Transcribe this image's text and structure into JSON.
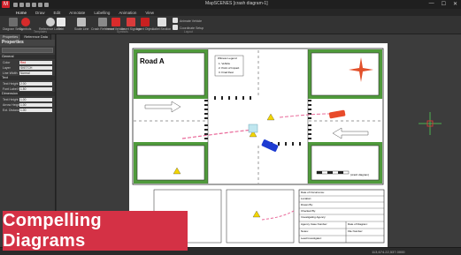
{
  "window": {
    "title": "MapSCENES [crash diagram-1]",
    "app_logo": "M",
    "controls": [
      "—",
      "☐",
      "✕"
    ]
  },
  "menu": {
    "tabs": [
      "Home",
      "Draw",
      "Edit",
      "Annotate",
      "Labelling",
      "Animation",
      "View"
    ],
    "active": "Home"
  },
  "ribbon": {
    "buttons": [
      {
        "label": "Diagram Setup",
        "icon": "diagram-setup-icon"
      },
      {
        "label": "Symbols",
        "icon": "symbols-icon"
      },
      {
        "label": "Reference Label",
        "icon": "reference-label-icon"
      },
      {
        "label": "Text",
        "icon": "text-icon"
      },
      {
        "label": "Scale Line",
        "icon": "scale-line-icon"
      },
      {
        "label": "Crash Reference",
        "icon": "crash-reference-icon"
      },
      {
        "label": "Insert Vehicle",
        "icon": "vehicle-icon"
      },
      {
        "label": "Insert Signage",
        "icon": "signage-icon"
      },
      {
        "label": "Insert Object",
        "icon": "object-icon"
      },
      {
        "label": "Label Section",
        "icon": "label-section-icon"
      },
      {
        "label": "Animate Vehicle",
        "icon": "animate-icon"
      },
      {
        "label": "Coordinate Setup",
        "icon": "coordinate-icon"
      }
    ],
    "groups": [
      "Templates",
      "Symbols",
      "Layout"
    ]
  },
  "panel": {
    "tabs": [
      "Properties",
      "Reference Data"
    ],
    "title": "Properties",
    "sections": [
      {
        "name": "General",
        "rows": [
          {
            "key": "Color",
            "value": "Red"
          },
          {
            "key": "Layer",
            "value": "SKETCH"
          },
          {
            "key": "Line Width",
            "value": "Normal"
          }
        ]
      },
      {
        "name": "Text",
        "rows": [
          {
            "key": "Text Height",
            "value": "2.00"
          },
          {
            "key": "Font Label Height",
            "value": "1.50"
          }
        ]
      },
      {
        "name": "Dimension",
        "rows": [
          {
            "key": "Text Height",
            "value": "1.00"
          },
          {
            "key": "Arrow Height",
            "value": "1.00"
          },
          {
            "key": "Ext. Distance",
            "value": "1.00"
          }
        ]
      }
    ]
  },
  "diagram": {
    "road_label": "Road A",
    "legend_title": "Witness Legend",
    "legend_items": [
      "1. Vehicle",
      "2. Point of Impact",
      "3. Final Rest"
    ],
    "info_rows": [
      "Date of Occurrence:",
      "Location:",
      "Drawn By:",
      "Checked By:",
      "Investigating Agency:",
      "Agency Case Number:",
      "Notes:",
      "Lead Investigator:",
      "Report Number:"
    ],
    "right_col": [
      "Date of Diagram:",
      "File Number:"
    ],
    "diagram_label": "(crash diagram)"
  },
  "banner": {
    "text": "Compelling Diagrams",
    "color": "#d43145"
  },
  "status": {
    "coordinates": "113,674.22,537.0000"
  }
}
